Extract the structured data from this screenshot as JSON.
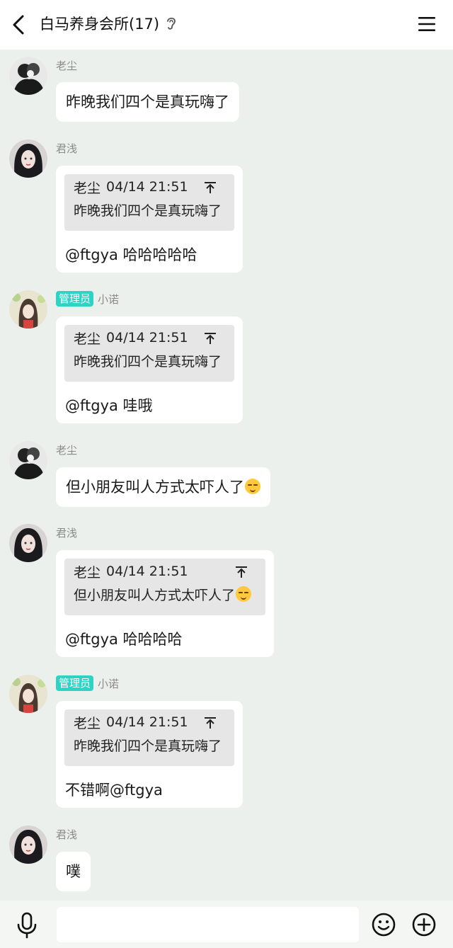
{
  "header": {
    "title": "白马养身会所(17)",
    "back_icon": "chevron-left-icon",
    "ear_icon": "ear-icon",
    "menu_icon": "hamburger-menu-icon"
  },
  "messages": [
    {
      "name": "老尘",
      "text": "昨晚我们四个是真玩嗨了"
    },
    {
      "name": "君浅",
      "quote": {
        "author": "老尘",
        "time": "04/14 21:51",
        "text": "昨晚我们四个是真玩嗨了"
      },
      "reply": "@ftgya 哈哈哈哈哈"
    },
    {
      "badge": "管理员",
      "name": "小诺",
      "quote": {
        "author": "老尘",
        "time": "04/14 21:51",
        "text": "昨晚我们四个是真玩嗨了"
      },
      "reply": "@ftgya 哇哦"
    },
    {
      "name": "老尘",
      "text": "但小朋友叫人方式太吓人了",
      "emoji": "relieved-face-emoji"
    },
    {
      "name": "君浅",
      "quote": {
        "author": "老尘",
        "time": "04/14 21:51",
        "text": "但小朋友叫人方式太吓人了",
        "emoji": "relieved-face-emoji"
      },
      "reply": "@ftgya 哈哈哈哈"
    },
    {
      "badge": "管理员",
      "name": "小诺",
      "quote": {
        "author": "老尘",
        "time": "04/14 21:51",
        "text": "昨晚我们四个是真玩嗨了"
      },
      "reply": "不错啊@ftgya"
    },
    {
      "name": "君浅",
      "text": "噗"
    }
  ],
  "input_bar": {
    "placeholder": "",
    "mic_icon": "microphone-icon",
    "emoji_icon": "smiley-icon",
    "plus_icon": "plus-circle-icon"
  },
  "colors": {
    "background": "#ecf0ec",
    "bubble": "#ffffff",
    "quote_background": "#e6e6e6",
    "admin_badge": "#2ed3c5",
    "name_text": "#8a8a8a"
  }
}
